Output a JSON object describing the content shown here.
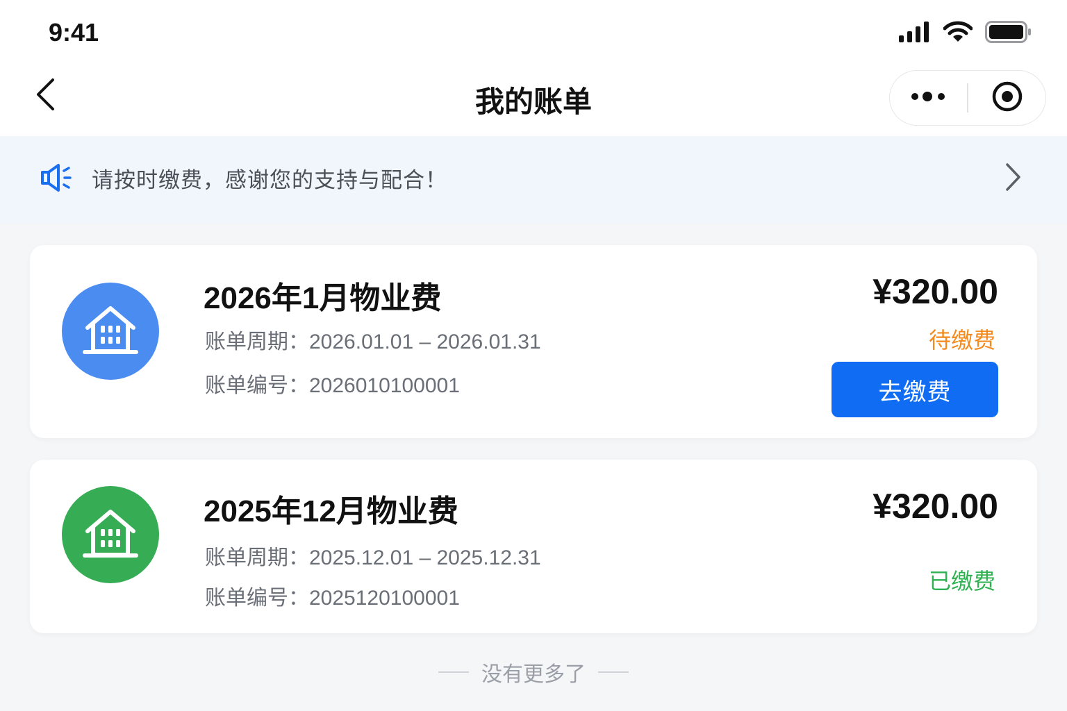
{
  "status_bar": {
    "time": "9:41"
  },
  "nav": {
    "title": "我的账单"
  },
  "notice": {
    "text": "请按时缴费，感谢您的支持与配合！"
  },
  "bills": [
    {
      "title": "2026年1月物业费",
      "period_label": "账单周期：",
      "period_value": "2026.01.01 – 2026.01.31",
      "no_label": "账单编号：",
      "no_value": "2026010100001",
      "amount": "¥320.00",
      "status": "待缴费",
      "status_color": "#f28a1e",
      "icon_color": "#4a8cf0",
      "action_label": "去缴费"
    },
    {
      "title": "2025年12月物业费",
      "period_label": "账单周期：",
      "period_value": "2025.12.01 – 2025.12.31",
      "no_label": "账单编号：",
      "no_value": "2025120100001",
      "amount": "¥320.00",
      "status": "已缴费",
      "status_color": "#2fb152",
      "icon_color": "#36ad55"
    }
  ],
  "footer": {
    "text": "没有更多了"
  },
  "colors": {
    "primary": "#0f6cf3",
    "notice_bg": "#f1f5fc",
    "page_bg": "#f5f6f8"
  },
  "icons": {
    "back": "chevron-left-icon",
    "more": "more-dots-icon",
    "close": "target-circle-icon",
    "notice": "megaphone-icon",
    "notice_arrow": "chevron-right-icon",
    "bill": "house-icon",
    "signal": "cellular-signal-icon",
    "wifi": "wifi-icon",
    "battery": "battery-icon"
  }
}
